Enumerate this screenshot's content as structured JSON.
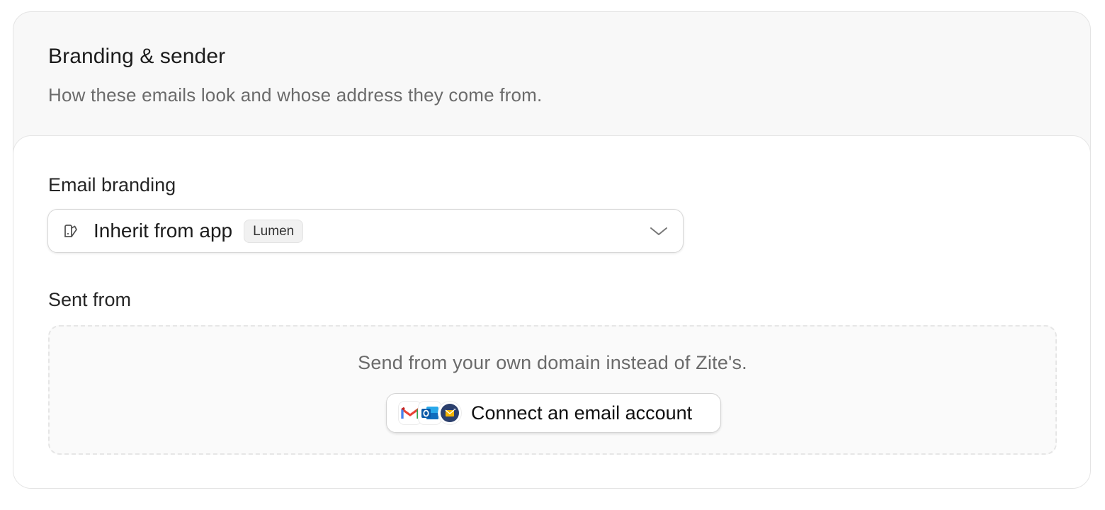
{
  "section": {
    "title": "Branding & sender",
    "subtitle": "How these emails look and whose address they come from."
  },
  "branding": {
    "label": "Email branding",
    "selected_value": "Inherit from app",
    "badge": "Lumen",
    "icon": "palette-icon"
  },
  "sender": {
    "label": "Sent from",
    "description": "Send from your own domain instead of Zite's.",
    "connect_button_label": "Connect an email account",
    "provider_icons": [
      "gmail-icon",
      "outlook-icon",
      "smtp-mail-icon"
    ]
  },
  "colors": {
    "header_bg": "#f8f8f8",
    "body_bg": "#ffffff",
    "muted_text": "#6b6b6b",
    "border": "#e4e4e4",
    "gmail_red": "#ea4335",
    "outlook_blue": "#0f6cbd",
    "smtp_navy": "#2b3f6c",
    "smtp_yellow": "#f4b400"
  }
}
